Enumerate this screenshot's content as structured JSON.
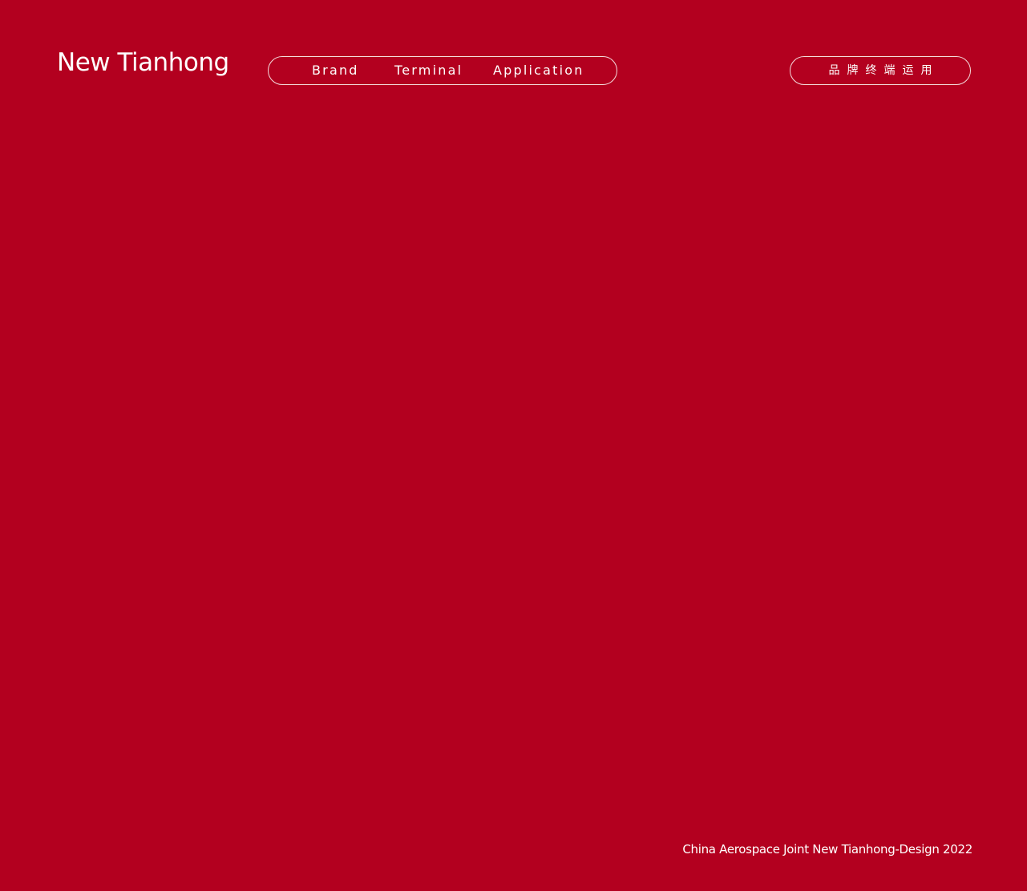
{
  "header": {
    "logo_text": "New Tianhong",
    "nav": {
      "items": [
        {
          "label": "Brand"
        },
        {
          "label": "Terminal"
        },
        {
          "label": "Application"
        }
      ]
    },
    "cn_label": "品牌终端运用"
  },
  "footer": {
    "text": "China Aerospace Joint New Tianhong-Design 2022"
  },
  "colors": {
    "background": "#B3001F",
    "foreground": "#FFFFFF"
  }
}
